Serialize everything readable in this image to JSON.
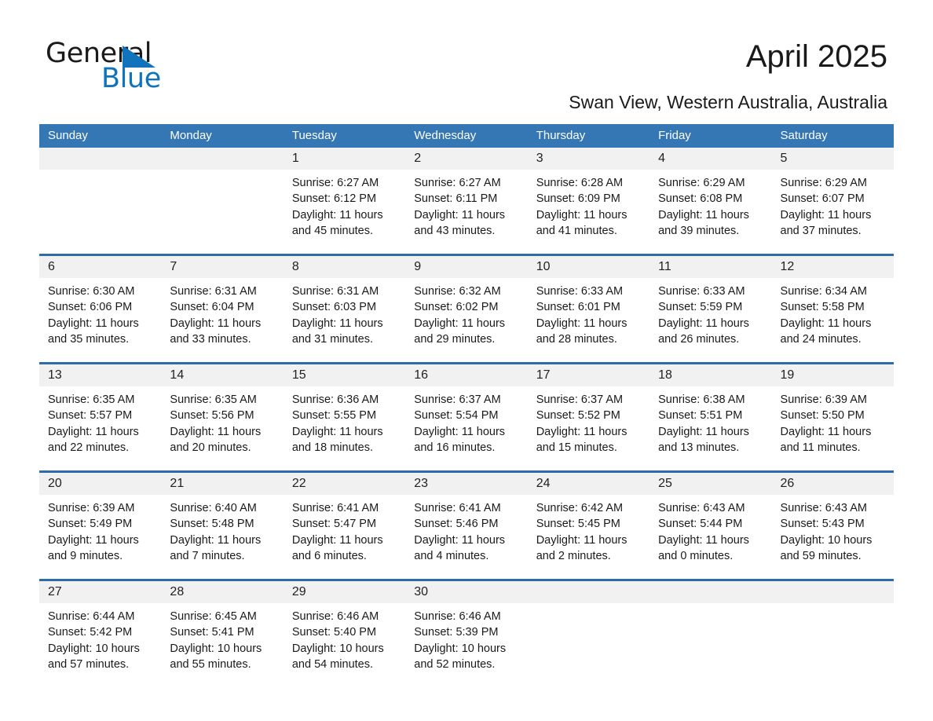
{
  "brand": {
    "name_part1": "General",
    "name_part2": "Blue",
    "accent_color": "#1273bd",
    "logo_icon": "triangle-icon"
  },
  "header": {
    "title": "April 2025",
    "location": "Swan View, Western Australia, Australia"
  },
  "calendar": {
    "header_bg": "#3576b5",
    "row_divider_color": "#2b6ca9",
    "daynum_band_bg": "#f1f1f1",
    "weekdays": [
      "Sunday",
      "Monday",
      "Tuesday",
      "Wednesday",
      "Thursday",
      "Friday",
      "Saturday"
    ],
    "weeks": [
      {
        "days": [
          {
            "num": "",
            "empty": true
          },
          {
            "num": "",
            "empty": true
          },
          {
            "num": "1",
            "sunrise": "Sunrise: 6:27 AM",
            "sunset": "Sunset: 6:12 PM",
            "daylight1": "Daylight: 11 hours",
            "daylight2": "and 45 minutes."
          },
          {
            "num": "2",
            "sunrise": "Sunrise: 6:27 AM",
            "sunset": "Sunset: 6:11 PM",
            "daylight1": "Daylight: 11 hours",
            "daylight2": "and 43 minutes."
          },
          {
            "num": "3",
            "sunrise": "Sunrise: 6:28 AM",
            "sunset": "Sunset: 6:09 PM",
            "daylight1": "Daylight: 11 hours",
            "daylight2": "and 41 minutes."
          },
          {
            "num": "4",
            "sunrise": "Sunrise: 6:29 AM",
            "sunset": "Sunset: 6:08 PM",
            "daylight1": "Daylight: 11 hours",
            "daylight2": "and 39 minutes."
          },
          {
            "num": "5",
            "sunrise": "Sunrise: 6:29 AM",
            "sunset": "Sunset: 6:07 PM",
            "daylight1": "Daylight: 11 hours",
            "daylight2": "and 37 minutes."
          }
        ]
      },
      {
        "days": [
          {
            "num": "6",
            "sunrise": "Sunrise: 6:30 AM",
            "sunset": "Sunset: 6:06 PM",
            "daylight1": "Daylight: 11 hours",
            "daylight2": "and 35 minutes."
          },
          {
            "num": "7",
            "sunrise": "Sunrise: 6:31 AM",
            "sunset": "Sunset: 6:04 PM",
            "daylight1": "Daylight: 11 hours",
            "daylight2": "and 33 minutes."
          },
          {
            "num": "8",
            "sunrise": "Sunrise: 6:31 AM",
            "sunset": "Sunset: 6:03 PM",
            "daylight1": "Daylight: 11 hours",
            "daylight2": "and 31 minutes."
          },
          {
            "num": "9",
            "sunrise": "Sunrise: 6:32 AM",
            "sunset": "Sunset: 6:02 PM",
            "daylight1": "Daylight: 11 hours",
            "daylight2": "and 29 minutes."
          },
          {
            "num": "10",
            "sunrise": "Sunrise: 6:33 AM",
            "sunset": "Sunset: 6:01 PM",
            "daylight1": "Daylight: 11 hours",
            "daylight2": "and 28 minutes."
          },
          {
            "num": "11",
            "sunrise": "Sunrise: 6:33 AM",
            "sunset": "Sunset: 5:59 PM",
            "daylight1": "Daylight: 11 hours",
            "daylight2": "and 26 minutes."
          },
          {
            "num": "12",
            "sunrise": "Sunrise: 6:34 AM",
            "sunset": "Sunset: 5:58 PM",
            "daylight1": "Daylight: 11 hours",
            "daylight2": "and 24 minutes."
          }
        ]
      },
      {
        "days": [
          {
            "num": "13",
            "sunrise": "Sunrise: 6:35 AM",
            "sunset": "Sunset: 5:57 PM",
            "daylight1": "Daylight: 11 hours",
            "daylight2": "and 22 minutes."
          },
          {
            "num": "14",
            "sunrise": "Sunrise: 6:35 AM",
            "sunset": "Sunset: 5:56 PM",
            "daylight1": "Daylight: 11 hours",
            "daylight2": "and 20 minutes."
          },
          {
            "num": "15",
            "sunrise": "Sunrise: 6:36 AM",
            "sunset": "Sunset: 5:55 PM",
            "daylight1": "Daylight: 11 hours",
            "daylight2": "and 18 minutes."
          },
          {
            "num": "16",
            "sunrise": "Sunrise: 6:37 AM",
            "sunset": "Sunset: 5:54 PM",
            "daylight1": "Daylight: 11 hours",
            "daylight2": "and 16 minutes."
          },
          {
            "num": "17",
            "sunrise": "Sunrise: 6:37 AM",
            "sunset": "Sunset: 5:52 PM",
            "daylight1": "Daylight: 11 hours",
            "daylight2": "and 15 minutes."
          },
          {
            "num": "18",
            "sunrise": "Sunrise: 6:38 AM",
            "sunset": "Sunset: 5:51 PM",
            "daylight1": "Daylight: 11 hours",
            "daylight2": "and 13 minutes."
          },
          {
            "num": "19",
            "sunrise": "Sunrise: 6:39 AM",
            "sunset": "Sunset: 5:50 PM",
            "daylight1": "Daylight: 11 hours",
            "daylight2": "and 11 minutes."
          }
        ]
      },
      {
        "days": [
          {
            "num": "20",
            "sunrise": "Sunrise: 6:39 AM",
            "sunset": "Sunset: 5:49 PM",
            "daylight1": "Daylight: 11 hours",
            "daylight2": "and 9 minutes."
          },
          {
            "num": "21",
            "sunrise": "Sunrise: 6:40 AM",
            "sunset": "Sunset: 5:48 PM",
            "daylight1": "Daylight: 11 hours",
            "daylight2": "and 7 minutes."
          },
          {
            "num": "22",
            "sunrise": "Sunrise: 6:41 AM",
            "sunset": "Sunset: 5:47 PM",
            "daylight1": "Daylight: 11 hours",
            "daylight2": "and 6 minutes."
          },
          {
            "num": "23",
            "sunrise": "Sunrise: 6:41 AM",
            "sunset": "Sunset: 5:46 PM",
            "daylight1": "Daylight: 11 hours",
            "daylight2": "and 4 minutes."
          },
          {
            "num": "24",
            "sunrise": "Sunrise: 6:42 AM",
            "sunset": "Sunset: 5:45 PM",
            "daylight1": "Daylight: 11 hours",
            "daylight2": "and 2 minutes."
          },
          {
            "num": "25",
            "sunrise": "Sunrise: 6:43 AM",
            "sunset": "Sunset: 5:44 PM",
            "daylight1": "Daylight: 11 hours",
            "daylight2": "and 0 minutes."
          },
          {
            "num": "26",
            "sunrise": "Sunrise: 6:43 AM",
            "sunset": "Sunset: 5:43 PM",
            "daylight1": "Daylight: 10 hours",
            "daylight2": "and 59 minutes."
          }
        ]
      },
      {
        "days": [
          {
            "num": "27",
            "sunrise": "Sunrise: 6:44 AM",
            "sunset": "Sunset: 5:42 PM",
            "daylight1": "Daylight: 10 hours",
            "daylight2": "and 57 minutes."
          },
          {
            "num": "28",
            "sunrise": "Sunrise: 6:45 AM",
            "sunset": "Sunset: 5:41 PM",
            "daylight1": "Daylight: 10 hours",
            "daylight2": "and 55 minutes."
          },
          {
            "num": "29",
            "sunrise": "Sunrise: 6:46 AM",
            "sunset": "Sunset: 5:40 PM",
            "daylight1": "Daylight: 10 hours",
            "daylight2": "and 54 minutes."
          },
          {
            "num": "30",
            "sunrise": "Sunrise: 6:46 AM",
            "sunset": "Sunset: 5:39 PM",
            "daylight1": "Daylight: 10 hours",
            "daylight2": "and 52 minutes."
          },
          {
            "num": "",
            "empty": true
          },
          {
            "num": "",
            "empty": true
          },
          {
            "num": "",
            "empty": true
          }
        ]
      }
    ]
  }
}
